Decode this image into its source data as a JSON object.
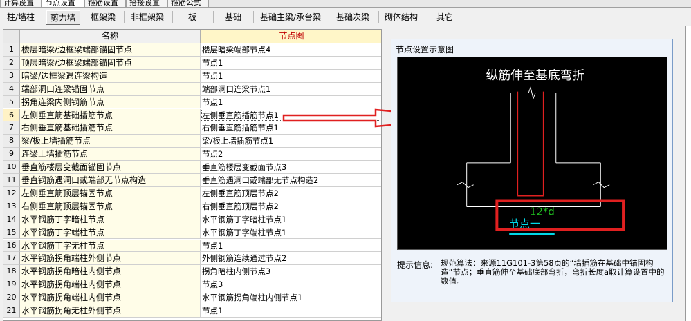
{
  "top_tabs": [
    "计算设置",
    "节点设置",
    "箍筋设置",
    "搭接设置",
    "箍筋公式"
  ],
  "sub_tabs": [
    "柱/墙柱",
    "剪力墙",
    "框架梁",
    "非框架梁",
    "板",
    "基础",
    "基础主梁/承台梁",
    "基础次梁",
    "砌体结构",
    "其它"
  ],
  "grid": {
    "col_name": "名称",
    "col_node": "节点图",
    "rows": [
      {
        "num": "1",
        "name": "楼层暗梁/边框梁端部锚固节点",
        "node": "楼层暗梁端部节点4"
      },
      {
        "num": "2",
        "name": "顶层暗梁/边框梁端部锚固节点",
        "node": "节点1"
      },
      {
        "num": "3",
        "name": "暗梁/边框梁遇连梁构造",
        "node": "节点1"
      },
      {
        "num": "4",
        "name": "端部洞口连梁锚固节点",
        "node": "端部洞口连梁节点1"
      },
      {
        "num": "5",
        "name": "拐角连梁内侧钢筋节点",
        "node": "节点1"
      },
      {
        "num": "6",
        "name": "左侧垂直筋基础插筋节点",
        "node": "左侧垂直筋插筋节点1"
      },
      {
        "num": "7",
        "name": "右侧垂直筋基础插筋节点",
        "node": "右侧垂直筋插筋节点1"
      },
      {
        "num": "8",
        "name": "梁/板上墙插筋节点",
        "node": "梁/板上墙插筋节点1"
      },
      {
        "num": "9",
        "name": "连梁上墙插筋节点",
        "node": "节点2"
      },
      {
        "num": "10",
        "name": "垂直筋楼层变截面锚固节点",
        "node": "垂直筋楼层变截面节点3"
      },
      {
        "num": "11",
        "name": "垂直钢筋遇洞口或端部无节点构造",
        "node": "垂直筋遇洞口或端部无节点构造2"
      },
      {
        "num": "12",
        "name": "左侧垂直筋顶层锚固节点",
        "node": "左侧垂直筋顶层节点2"
      },
      {
        "num": "13",
        "name": "右侧垂直筋顶层锚固节点",
        "node": "右侧垂直筋顶层节点2"
      },
      {
        "num": "14",
        "name": "水平钢筋丁字暗柱节点",
        "node": "水平钢筋丁字暗柱节点1"
      },
      {
        "num": "15",
        "name": "水平钢筋丁字端柱节点",
        "node": "水平钢筋丁字端柱节点1"
      },
      {
        "num": "16",
        "name": "水平钢筋丁字无柱节点",
        "node": "节点1"
      },
      {
        "num": "17",
        "name": "水平钢筋拐角端柱外侧节点",
        "node": "外侧钢筋连续通过节点2"
      },
      {
        "num": "18",
        "name": "水平钢筋拐角暗柱内侧节点",
        "node": "拐角暗柱内侧节点3"
      },
      {
        "num": "19",
        "name": "水平钢筋拐角端柱内侧节点",
        "node": "节点3"
      },
      {
        "num": "20",
        "name": "水平钢筋拐角端柱内侧节点",
        "node": "水平钢筋拐角端柱内侧节点1"
      },
      {
        "num": "21",
        "name": "水平钢筋拐角无柱外侧节点",
        "node": "节点1"
      }
    ]
  },
  "panel": {
    "title": "节点设置示意图",
    "diagram_caption": "纵筋伸至基底弯折",
    "diagram_dim": "12*d",
    "diagram_node_label": "节点一",
    "hint_label": "提示信息:",
    "hint_text": "规范算法：来源11G101-3第58页的“墙插筋在基础中锚固构造”节点；垂直筋伸至基础底部弯折，弯折长度a取计算设置中的数值。"
  },
  "colors": {
    "highlight_red": "#e02020",
    "dim_green": "#20c020",
    "label_cyan": "#00d8e8",
    "header_red": "#c00000"
  }
}
